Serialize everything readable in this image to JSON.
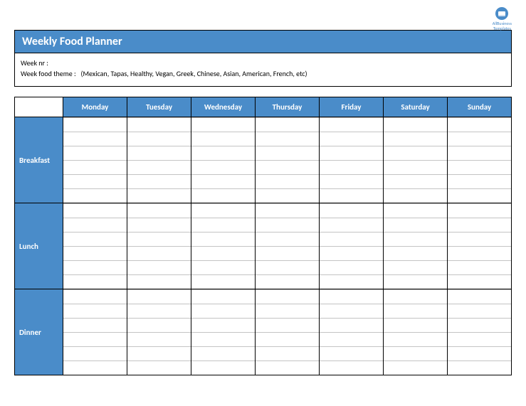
{
  "logo": {
    "line1": "AllBusiness",
    "line2": "Templates"
  },
  "title": "Weekly Food Planner",
  "meta": {
    "week_nr_label": "Week nr :",
    "theme_label": "Week food theme :",
    "theme_value": "(Mexican, Tapas, Healthy, Vegan, Greek, Chinese, Asian, American, French, etc)"
  },
  "days": [
    "Monday",
    "Tuesday",
    "Wednesday",
    "Thursday",
    "Friday",
    "Saturday",
    "Sunday"
  ],
  "meals": [
    "Breakfast",
    "Lunch",
    "Dinner"
  ]
}
